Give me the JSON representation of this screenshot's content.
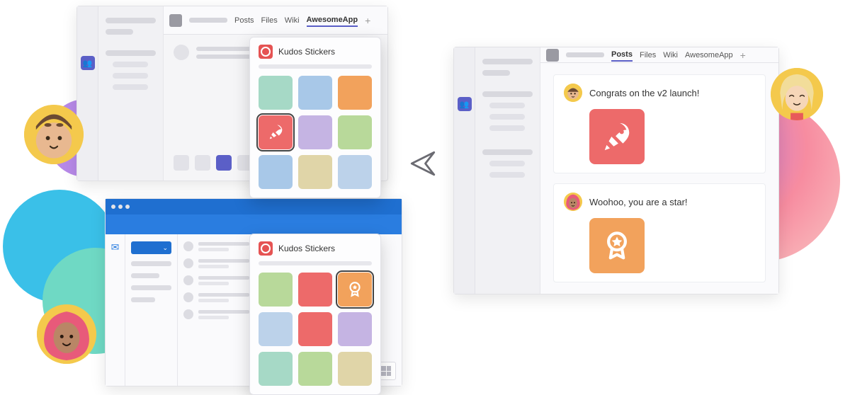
{
  "tabs": {
    "posts": "Posts",
    "files": "Files",
    "wiki": "Wiki",
    "awesome": "AwesomeApp"
  },
  "popover": {
    "title": "Kudos Stickers"
  },
  "stickers": {
    "rocket_icon": "rocket-icon",
    "award_icon": "award-ribbon-icon"
  },
  "messages": {
    "post1": "Congrats on the v2 launch!",
    "post2": "Woohoo, you are a star!"
  },
  "colors": {
    "brand_purple": "#5b5fc7",
    "brand_blue": "#1f6fd0",
    "sticker_red": "#ed6a6a",
    "sticker_orange": "#f2a25c"
  }
}
